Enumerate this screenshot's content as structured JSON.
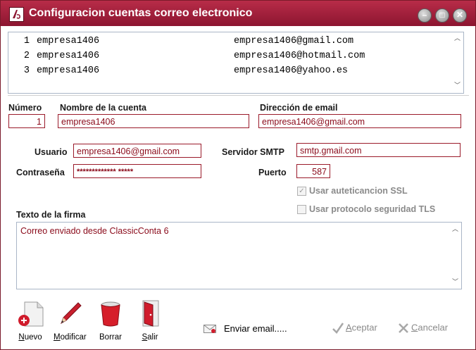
{
  "window": {
    "title": "Configuracion cuentas correo electronico",
    "title_bar_color": "#a32040",
    "accent_color": "#9a1a2a"
  },
  "accounts": [
    {
      "num": "1",
      "name": "empresa1406",
      "email": "empresa1406@gmail.com"
    },
    {
      "num": "2",
      "name": "empresa1406",
      "email": "empresa1406@hotmail.com"
    },
    {
      "num": "3",
      "name": "empresa1406",
      "email": "empresa1406@yahoo.es"
    }
  ],
  "form": {
    "numero_label": "Número",
    "numero_value": "1",
    "nombre_label": "Nombre de la cuenta",
    "nombre_value": "empresa1406",
    "direccion_label": "Dirección de email",
    "direccion_value": "empresa1406@gmail.com",
    "usuario_label": "Usuario",
    "usuario_value": "empresa1406@gmail.com",
    "contrasena_label": "Contraseña",
    "contrasena_value": "************* *****",
    "smtp_label": "Servidor SMTP",
    "smtp_value": "smtp.gmail.com",
    "puerto_label": "Puerto",
    "puerto_value": "587",
    "ssl_label": "Usar auteticancion SSL",
    "ssl_checked": true,
    "tls_label": "Usar protocolo seguridad TLS",
    "tls_checked": false,
    "firma_label": "Texto de la firma",
    "firma_value": "Correo enviado desde ClassicConta 6"
  },
  "toolbar": {
    "nuevo_hot": "N",
    "nuevo_rest": "uevo",
    "modificar_hot": "M",
    "modificar_rest": "odificar",
    "borrar_label": "Borrar",
    "salir_hot": "S",
    "salir_rest": "alir",
    "send_label": "Enviar email.....",
    "aceptar_hot": "A",
    "aceptar_rest": "ceptar",
    "cancelar_hot": "C",
    "cancelar_rest": "ancelar"
  }
}
